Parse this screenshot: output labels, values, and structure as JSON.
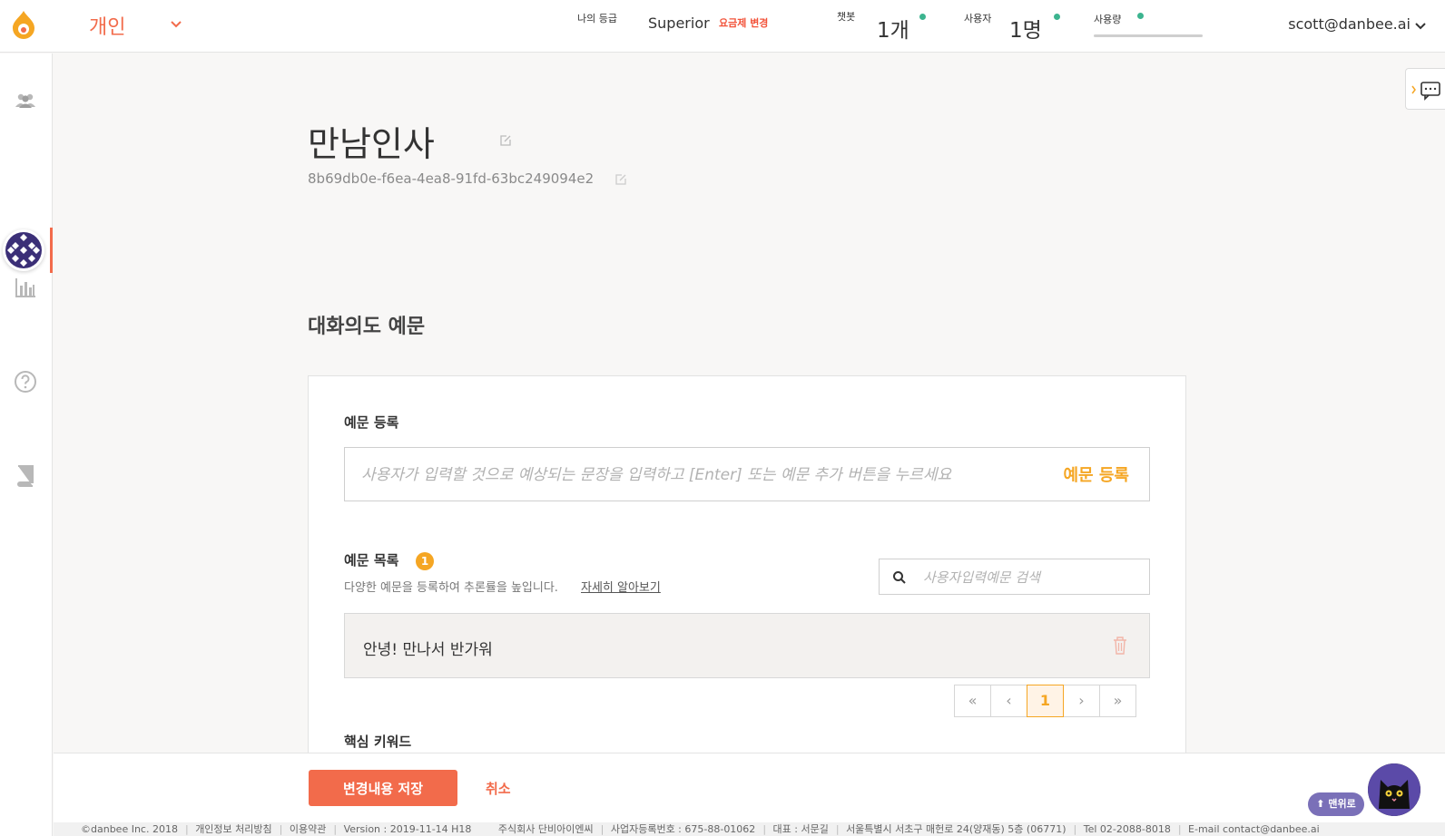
{
  "header": {
    "workspace": "개인",
    "grade_label": "나의 등급",
    "grade_value": "Superior",
    "plan_change": "요금제 변경",
    "chatbot_label": "챗봇",
    "chatbot_value": "1개",
    "user_label": "사용자",
    "user_value": "1명",
    "usage_label": "사용량",
    "account": "scott@danbee.ai"
  },
  "colors": {
    "accent": "#f26b4b",
    "highlight": "#f5a623",
    "status_dot": "#3cb48f"
  },
  "sidebar": {
    "icons": [
      "users-icon",
      "bot-avatar",
      "bar-chart-icon",
      "help-icon",
      "book-icon"
    ]
  },
  "bot": {
    "title": "만남인사",
    "id": "8b69db0e-f6ea-4ea8-91fd-63bc249094e2"
  },
  "section": {
    "title": "대화의도 예문",
    "register_label": "예문 등록",
    "register_placeholder": "사용자가 입력할 것으로 예상되는 문장을 입력하고 [Enter] 또는 예문 추가 버튼을 누르세요",
    "register_button": "예문 등록",
    "list_label": "예문 목록",
    "list_count": "1",
    "hint": "다양한 예문을 등록하여 추론률을 높입니다.",
    "hint_link": "자세히 알아보기",
    "search_placeholder": "사용자입력예문 검색",
    "examples": [
      "안녕! 만나서 반가워"
    ],
    "pager": {
      "first": "«",
      "prev": "‹",
      "current": "1",
      "next": "›",
      "last": "»"
    },
    "keyword_label": "핵심 키워드"
  },
  "actions": {
    "save": "변경내용 저장",
    "cancel": "취소"
  },
  "footer": {
    "copyright": "©danbee Inc. 2018",
    "privacy": "개인정보 처리방침",
    "terms": "이용약관",
    "version": "Version : 2019-11-14  H18",
    "company": "주식회사 단비아이엔씨",
    "biz_no": "사업자등록번호 : 675-88-01062",
    "ceo": "대표 : 서문길",
    "address": "서울특별시 서초구 매헌로 24(양재동) 5층 (06771)",
    "tel": "Tel 02-2088-8018",
    "email": "E-mail contact@danbee.ai"
  },
  "widgets": {
    "to_top": "⬆ 맨위로"
  }
}
